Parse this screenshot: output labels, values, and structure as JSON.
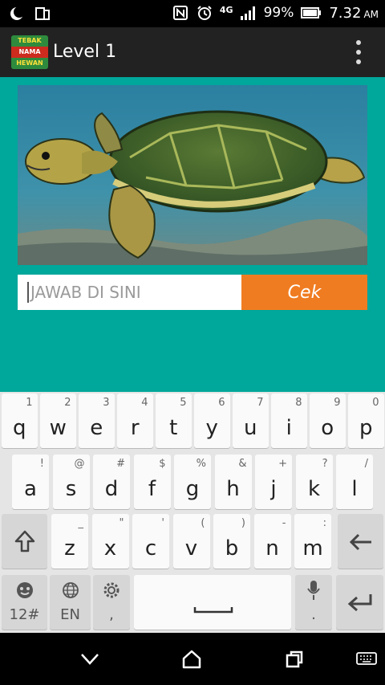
{
  "status": {
    "battery": "99%",
    "network": "4G",
    "time": "7.32",
    "ampm": "AM"
  },
  "app": {
    "logo_lines": [
      "TEBAK",
      "NAMA",
      "HEWAN"
    ],
    "title": "Level 1"
  },
  "question": {
    "answer_placeholder": "JAWAB DI SINI",
    "check_label": "Cek"
  },
  "keyboard": {
    "row1": [
      [
        "q",
        "1"
      ],
      [
        "w",
        "2"
      ],
      [
        "e",
        "3"
      ],
      [
        "r",
        "4"
      ],
      [
        "t",
        "5"
      ],
      [
        "y",
        "6"
      ],
      [
        "u",
        "7"
      ],
      [
        "i",
        "8"
      ],
      [
        "o",
        "9"
      ],
      [
        "p",
        "0"
      ]
    ],
    "row2": [
      [
        "a",
        "!"
      ],
      [
        "s",
        "@"
      ],
      [
        "d",
        "#"
      ],
      [
        "f",
        "$"
      ],
      [
        "g",
        "%"
      ],
      [
        "h",
        "&"
      ],
      [
        "j",
        "+"
      ],
      [
        "k",
        "?"
      ],
      [
        "l",
        "/"
      ]
    ],
    "row3": [
      [
        "z",
        "_"
      ],
      [
        "x",
        "\""
      ],
      [
        "c",
        "'"
      ],
      [
        "v",
        "("
      ],
      [
        "b",
        ")"
      ],
      [
        "n",
        "-"
      ],
      [
        "m",
        ":"
      ]
    ],
    "symbols_label": "12#",
    "language_label": "EN",
    "comma_label": ",",
    "period_label": "."
  }
}
